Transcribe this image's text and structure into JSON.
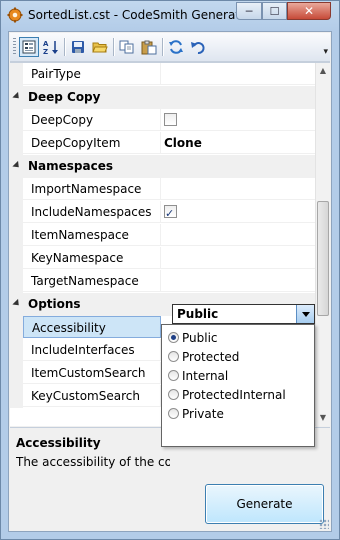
{
  "window": {
    "title": "SortedList.cst - CodeSmith Generator",
    "minimize_glyph": "─",
    "maximize_glyph": "☐",
    "close_glyph": "✕"
  },
  "toolbar": {
    "buttons": [
      {
        "name": "categorized-view-icon"
      },
      {
        "name": "alphabetical-sort-icon"
      },
      {
        "name": "save-icon"
      },
      {
        "name": "open-folder-icon"
      },
      {
        "name": "copy-icon"
      },
      {
        "name": "paste-icon"
      },
      {
        "name": "refresh-icon"
      },
      {
        "name": "undo-icon"
      }
    ],
    "overflow_glyph": "▾"
  },
  "grid": {
    "rows": [
      {
        "type": "prop",
        "label": "PairType",
        "value": ""
      },
      {
        "type": "cat",
        "label": "Deep Copy"
      },
      {
        "type": "prop",
        "label": "DeepCopy",
        "value": "",
        "checkbox": false
      },
      {
        "type": "prop",
        "label": "DeepCopyItem",
        "value": "Clone",
        "bold": true
      },
      {
        "type": "cat",
        "label": "Namespaces"
      },
      {
        "type": "prop",
        "label": "ImportNamespace",
        "value": ""
      },
      {
        "type": "prop",
        "label": "IncludeNamespaces",
        "value": "",
        "checkbox": true
      },
      {
        "type": "prop",
        "label": "ItemNamespace",
        "value": ""
      },
      {
        "type": "prop",
        "label": "KeyNamespace",
        "value": ""
      },
      {
        "type": "prop",
        "label": "TargetNamespace",
        "value": ""
      },
      {
        "type": "cat",
        "label": "Options"
      },
      {
        "type": "prop",
        "label": "Accessibility",
        "value": "Public",
        "selected": true
      },
      {
        "type": "prop",
        "label": "IncludeInterfaces",
        "value": ""
      },
      {
        "type": "prop",
        "label": "ItemCustomSearch",
        "value": ""
      },
      {
        "type": "prop",
        "label": "KeyCustomSearch",
        "value": ""
      }
    ],
    "editor_value": "Public",
    "dropdown_options": [
      "Public",
      "Protected",
      "Internal",
      "ProtectedInternal",
      "Private"
    ],
    "dropdown_selected": "Public"
  },
  "help": {
    "title": "Accessibility",
    "description": "The accessibility of the colle"
  },
  "generate_button": "Generate",
  "colors": {
    "selection_bg": "#cde5f7",
    "category_bg": "#f0f0f0",
    "accent": "#3c7fb1"
  }
}
